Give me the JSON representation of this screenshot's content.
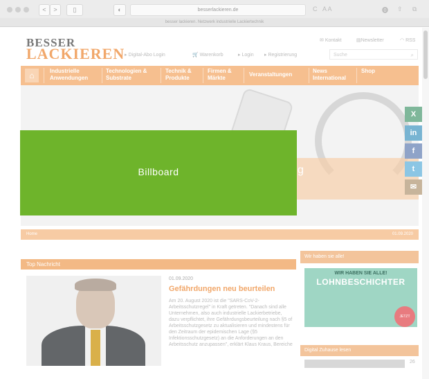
{
  "browser": {
    "url": "besserlackieren.de",
    "tab_title": "besser lackieren. Netzwerk industrielle Lackiertechnik",
    "back": "<",
    "forward": ">",
    "sidebar": "▯",
    "reload": "C",
    "reader": "A A"
  },
  "site": {
    "logo_line1": "BESSER",
    "logo_line2": "LACKIEREN",
    "links": [
      "Digital-Abo Login",
      "Warenkorb",
      "Login",
      "Registrierung"
    ],
    "utility": [
      "Kontakt",
      "Newsletter",
      "RSS"
    ],
    "search_placeholder": "Suche"
  },
  "nav": {
    "home_icon": "home-icon",
    "items": [
      {
        "line1": "Industrielle",
        "line2": "Anwendungen"
      },
      {
        "line1": "Technologien &",
        "line2": "Substrate"
      },
      {
        "line1": "Technik &",
        "line2": "Produkte"
      },
      {
        "line1": "Firmen &",
        "line2": "Märkte"
      },
      {
        "line1": "Veranstaltungen",
        "line2": ""
      },
      {
        "line1": "News",
        "line2": "International"
      },
      {
        "line1": "Shop",
        "line2": ""
      }
    ]
  },
  "hero": {
    "text": "g"
  },
  "billboard": {
    "label": "Billboard"
  },
  "social": [
    "X",
    "in",
    "f",
    "t",
    "✉"
  ],
  "breadcrumb": {
    "home": "Home",
    "date": "01.09.2020"
  },
  "top_news": {
    "heading": "Top Nachricht",
    "date": "01.09.2020",
    "title": "Gefährdungen neu beurteilen",
    "body": "Am 20. August 2020 ist die \"SARS-CoV-2-Arbeitsschutzregel\" in Kraft getreten. \"Danach sind alle Unternehmen, also auch industrielle Lackierbetriebe, dazu verpflichtet, ihre Gefährdungsbeurteilung nach §5 of Arbeitsschutzgesetz zu aktualisieren und mindestens für den Zeitraum der epidemischen Lage (§5 Infektionsschutzgesetz) an die Anforderungen an den Arbeitsschutz anzupassen\", erklärt Klaus Kraus, Bereiche"
  },
  "sidebar": {
    "heading1": "Wir haben sie alle!",
    "ad_small": "WIR HABEN SIE ALLE!",
    "ad_big": "LOHNBESCHICHTER",
    "ad_badge": "JETZT ENTDECKEN",
    "heading2": "Digital Zuhause lesen",
    "thumb_label": "26"
  }
}
